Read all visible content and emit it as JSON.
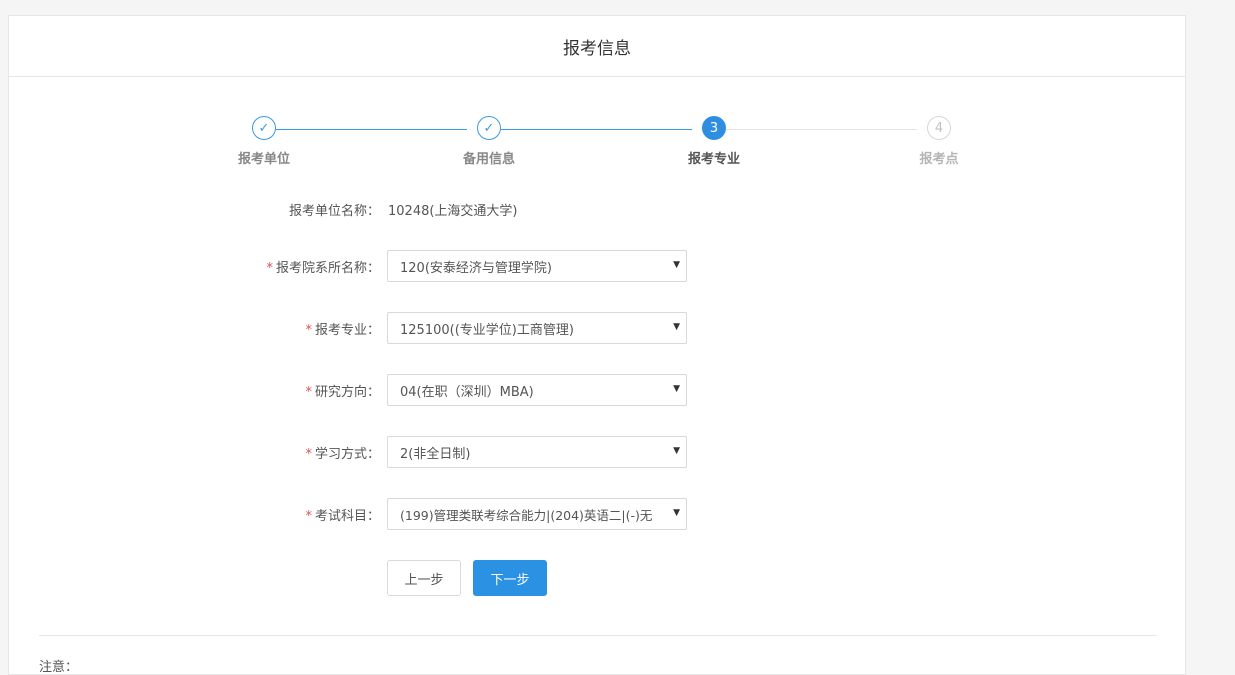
{
  "header": {
    "title": "报考信息"
  },
  "steps": [
    {
      "index": "✓",
      "label": "报考单位",
      "state": "done"
    },
    {
      "index": "✓",
      "label": "备用信息",
      "state": "done"
    },
    {
      "index": "3",
      "label": "报考专业",
      "state": "active"
    },
    {
      "index": "4",
      "label": "报考点",
      "state": "todo"
    }
  ],
  "form": {
    "unit": {
      "label": "报考单位名称：",
      "value": "10248(上海交通大学)"
    },
    "department": {
      "required": "*",
      "label": "报考院系所名称：",
      "value": "120(安泰经济与管理学院)"
    },
    "major": {
      "required": "*",
      "label": "报考专业：",
      "value": "125100((专业学位)工商管理)"
    },
    "direction": {
      "required": "*",
      "label": "研究方向：",
      "value": "04(在职（深圳）MBA)"
    },
    "study_mode": {
      "required": "*",
      "label": "学习方式：",
      "value": "2(非全日制)"
    },
    "subjects": {
      "required": "*",
      "label": "考试科目：",
      "value": "(199)管理类联考综合能力|(204)英语二|(-)无"
    },
    "caret": "▼"
  },
  "buttons": {
    "prev": "上一步",
    "next": "下一步"
  },
  "note": {
    "label": "注意："
  },
  "colors": {
    "primary": "#2b91e3",
    "required": "#d9534f",
    "border": "#d9d9d9"
  }
}
